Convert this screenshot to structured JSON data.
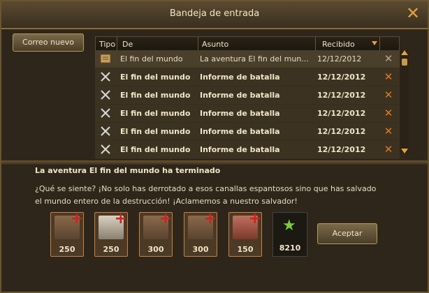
{
  "window": {
    "title": "Bandeja de entrada"
  },
  "toolbar": {
    "new_mail": "Correo nuevo"
  },
  "table": {
    "headers": {
      "tipo": "Tipo",
      "de": "De",
      "asunto": "Asunto",
      "recibido": "Recibido"
    },
    "rows": [
      {
        "from": "El fin del mundo",
        "subject": "La aventura El fin del mun...",
        "date": "12/12/2012",
        "type": "scroll-icon",
        "selected": true
      },
      {
        "from": "El fin del mundo",
        "subject": "Informe de batalla",
        "date": "12/12/2012",
        "type": "swords-icon"
      },
      {
        "from": "El fin del mundo",
        "subject": "Informe de batalla",
        "date": "12/12/2012",
        "type": "swords-icon"
      },
      {
        "from": "El fin del mundo",
        "subject": "Informe de batalla",
        "date": "12/12/2012",
        "type": "swords-icon"
      },
      {
        "from": "El fin del mundo",
        "subject": "Informe de batalla",
        "date": "12/12/2012",
        "type": "swords-icon"
      },
      {
        "from": "El fin del mundo",
        "subject": "Informe de batalla",
        "date": "12/12/2012",
        "type": "swords-icon"
      }
    ]
  },
  "message": {
    "title": "La aventura El fin del mundo ha terminado",
    "body_line1": "¿Qué se siente? ¡No solo has derrotado a esos canallas espantosos sino que has salvado",
    "body_line2": "el mundo entero de la destrucción! ¡Aclamemos a nuestro salvador!"
  },
  "rewards": [
    {
      "qty": "250",
      "icon": "stone-blocks-icon"
    },
    {
      "qty": "250",
      "icon": "marble-blocks-icon"
    },
    {
      "qty": "300",
      "icon": "bows-icon"
    },
    {
      "qty": "300",
      "icon": "bows-icon"
    },
    {
      "qty": "150",
      "icon": "sausages-icon"
    }
  ],
  "xp": {
    "qty": "8210",
    "icon": "star-icon"
  },
  "actions": {
    "accept": "Aceptar"
  }
}
